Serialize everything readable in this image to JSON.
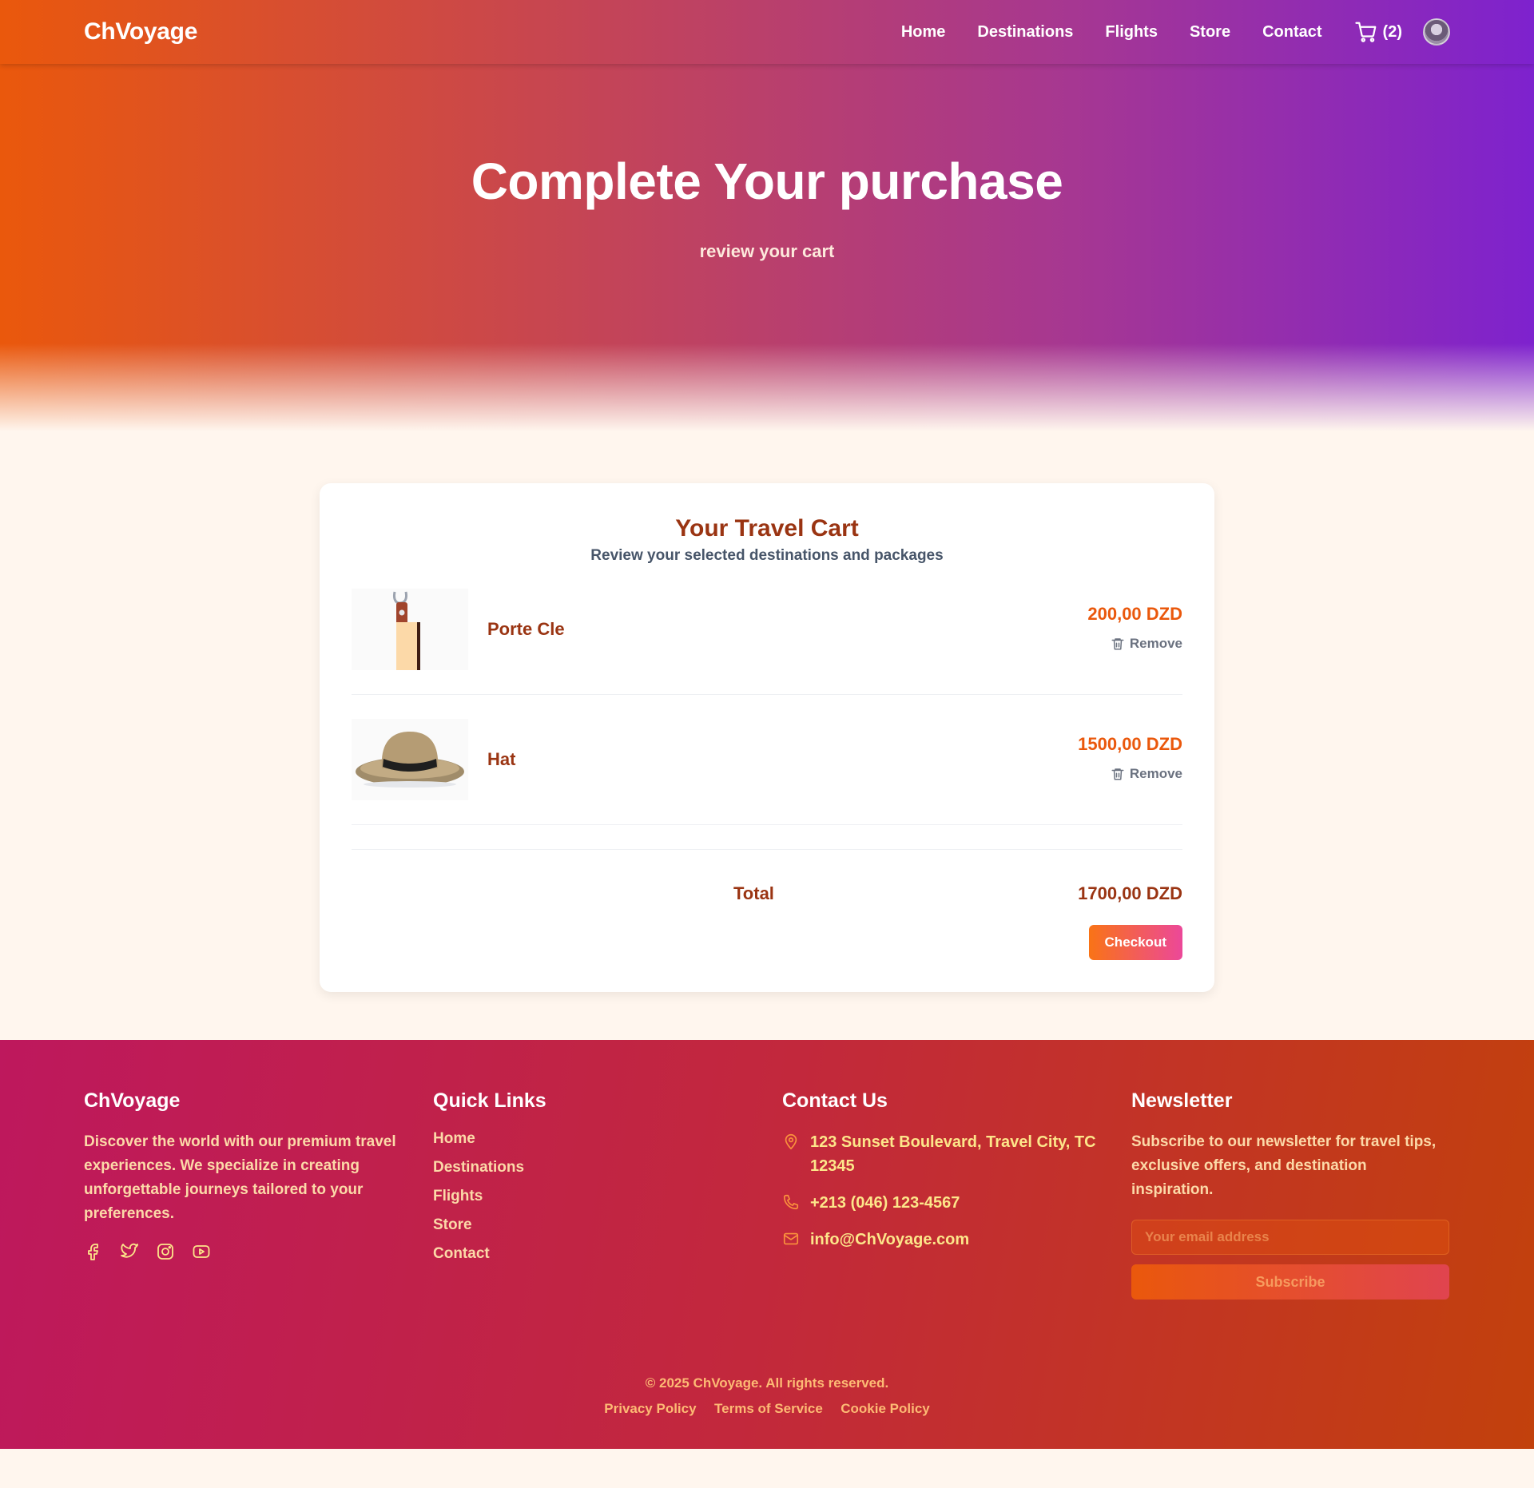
{
  "header": {
    "brand": "ChVoyage",
    "nav": [
      "Home",
      "Destinations",
      "Flights",
      "Store",
      "Contact"
    ],
    "cart_count": "(2)"
  },
  "hero": {
    "title": "Complete Your purchase",
    "subtitle": "review your cart"
  },
  "cart": {
    "title": "Your Travel Cart",
    "subtitle": "Review your selected destinations and packages",
    "items": [
      {
        "name": "Porte Cle",
        "price": "200,00 DZD",
        "remove_label": "Remove",
        "image": "keychain"
      },
      {
        "name": "Hat",
        "price": "1500,00 DZD",
        "remove_label": "Remove",
        "image": "hat"
      }
    ],
    "total_label": "Total",
    "total_value": "1700,00 DZD",
    "checkout_label": "Checkout"
  },
  "footer": {
    "about": {
      "title": "ChVoyage",
      "text": "Discover the world with our premium travel experiences. We specialize in creating unforgettable journeys tailored to your preferences.",
      "socials": [
        "facebook-icon",
        "twitter-icon",
        "instagram-icon",
        "youtube-icon"
      ]
    },
    "quick_links": {
      "title": "Quick Links",
      "links": [
        "Home",
        "Destinations",
        "Flights",
        "Store",
        "Contact"
      ]
    },
    "contact": {
      "title": "Contact Us",
      "address": "123 Sunset Boulevard, Travel City, TC 12345",
      "phone": "+213 (046) 123-4567",
      "email": "info@ChVoyage.com"
    },
    "newsletter": {
      "title": "Newsletter",
      "text": "Subscribe to our newsletter for travel tips, exclusive offers, and destination inspiration.",
      "email_placeholder": "Your email address",
      "subscribe_label": "Subscribe"
    },
    "copyright": "© 2025 ChVoyage. All rights reserved.",
    "legal_links": [
      "Privacy Policy",
      "Terms of Service",
      "Cookie Policy"
    ]
  },
  "colors": {
    "accent": "#ea580c",
    "heading": "#9a3412",
    "hero_gradient_start": "#ea580c",
    "hero_gradient_end": "#7e22ce",
    "footer_gradient_start": "#be185d",
    "footer_gradient_end": "#c2410c"
  }
}
